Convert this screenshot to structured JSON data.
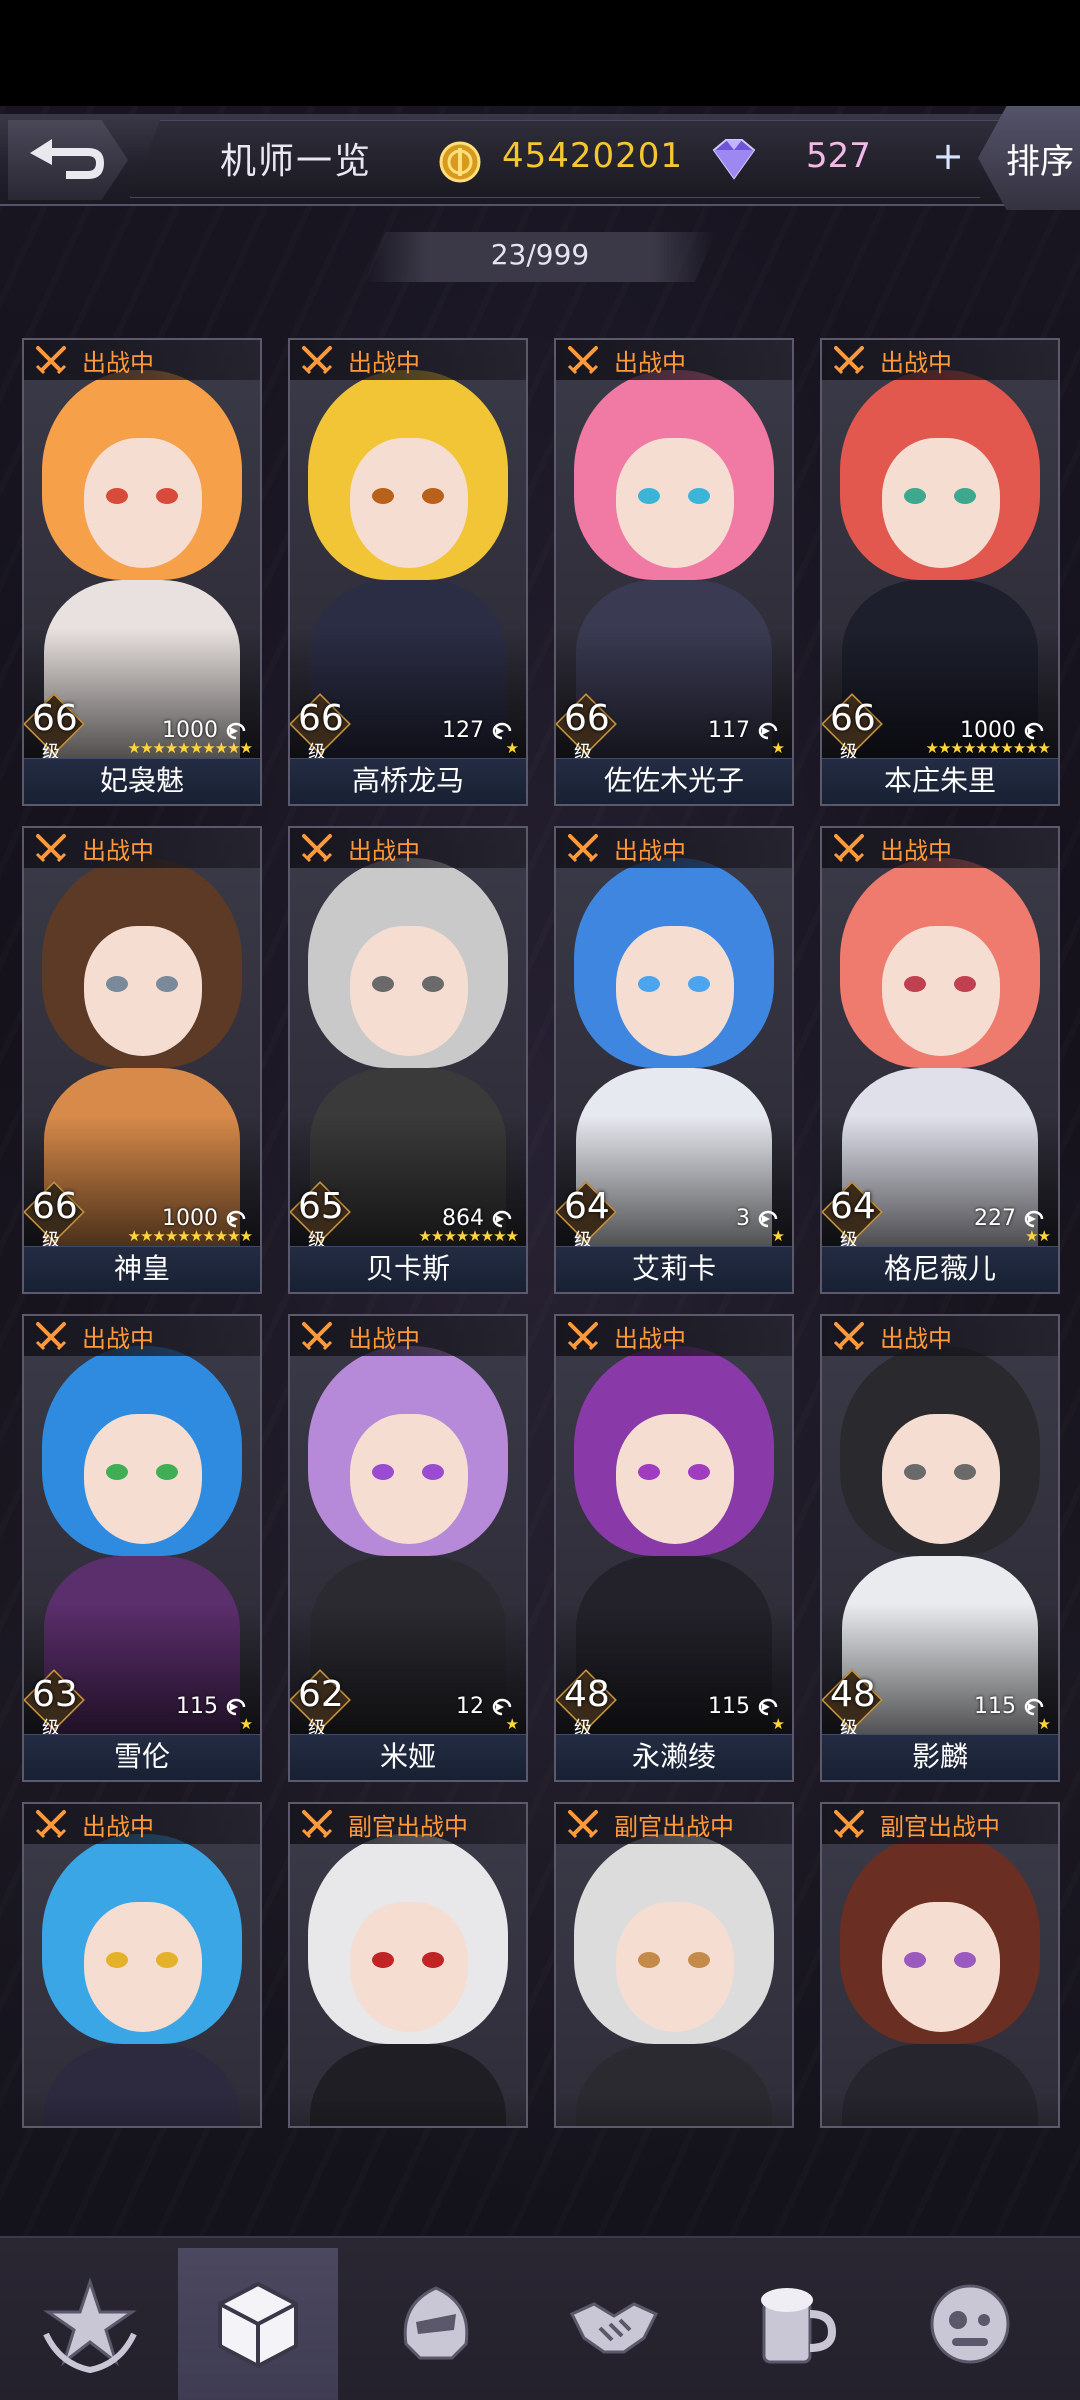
{
  "header": {
    "title": "机师一览",
    "coins": "45420201",
    "gems": "527",
    "add_label": "+",
    "sort_label": "排序",
    "pilot_count": "23/999"
  },
  "level_unit": "级",
  "cards": [
    {
      "name": "妃袅魅",
      "status": "出战中",
      "level": "66",
      "count": "1000",
      "stars": 10,
      "hair": "#f6a04a",
      "eyes": "#d84a3a",
      "outfit": "#e8e1df"
    },
    {
      "name": "高桥龙马",
      "status": "出战中",
      "level": "66",
      "count": "127",
      "stars": 1,
      "hair": "#f2c537",
      "eyes": "#b8611a",
      "outfit": "#2b2d44"
    },
    {
      "name": "佐佐木光子",
      "status": "出战中",
      "level": "66",
      "count": "117",
      "stars": 1,
      "hair": "#f07aa4",
      "eyes": "#3bb4d8",
      "outfit": "#3a3a52"
    },
    {
      "name": "本庄朱里",
      "status": "出战中",
      "level": "66",
      "count": "1000",
      "stars": 10,
      "hair": "#e2574e",
      "eyes": "#3ea88f",
      "outfit": "#1d1f2c"
    },
    {
      "name": "神皇",
      "status": "出战中",
      "level": "66",
      "count": "1000",
      "stars": 10,
      "hair": "#5c3a26",
      "eyes": "#7a8a9a",
      "outfit": "#d78a4a"
    },
    {
      "name": "贝卡斯",
      "status": "出战中",
      "level": "65",
      "count": "864",
      "stars": 8,
      "hair": "#c9c9c9",
      "eyes": "#6a6a6a",
      "outfit": "#3a3a3a"
    },
    {
      "name": "艾莉卡",
      "status": "出战中",
      "level": "64",
      "count": "3",
      "stars": 1,
      "hair": "#3e86e0",
      "eyes": "#4aa4ee",
      "outfit": "#e6e9ef"
    },
    {
      "name": "格尼薇儿",
      "status": "出战中",
      "level": "64",
      "count": "227",
      "stars": 2,
      "hair": "#ef7a6e",
      "eyes": "#c04050",
      "outfit": "#dfe0ea"
    },
    {
      "name": "雪伦",
      "status": "出战中",
      "level": "63",
      "count": "115",
      "stars": 1,
      "hair": "#2f8be0",
      "eyes": "#3fae54",
      "outfit": "#5b2e6c"
    },
    {
      "name": "米娅",
      "status": "出战中",
      "level": "62",
      "count": "12",
      "stars": 1,
      "hair": "#b68ad8",
      "eyes": "#9b4bd0",
      "outfit": "#2a2a30"
    },
    {
      "name": "永濑绫",
      "status": "出战中",
      "level": "48",
      "count": "115",
      "stars": 1,
      "hair": "#8a3aa8",
      "eyes": "#a03cc0",
      "outfit": "#23222a"
    },
    {
      "name": "影麟",
      "status": "出战中",
      "level": "48",
      "count": "115",
      "stars": 1,
      "hair": "#2a2a2e",
      "eyes": "#6a6a6a",
      "outfit": "#e9ebee"
    },
    {
      "name": "",
      "status": "出战中",
      "level": "",
      "count": "",
      "stars": 0,
      "hair": "#3aa6e6",
      "eyes": "#e4b12a",
      "outfit": "#2d2a40"
    },
    {
      "name": "",
      "status": "副官出战中",
      "level": "",
      "count": "",
      "stars": 0,
      "hair": "#e8e8ea",
      "eyes": "#c02424",
      "outfit": "#1e1e24"
    },
    {
      "name": "",
      "status": "副官出战中",
      "level": "",
      "count": "",
      "stars": 0,
      "hair": "#dcdcdc",
      "eyes": "#c48a4a",
      "outfit": "#2a2a30"
    },
    {
      "name": "",
      "status": "副官出战中",
      "level": "",
      "count": "",
      "stars": 0,
      "hair": "#6a2e22",
      "eyes": "#9a5ac0",
      "outfit": "#26242c"
    }
  ],
  "nav": [
    {
      "label": "基地",
      "icon": "base-star-icon",
      "active": false
    },
    {
      "label": "仓库",
      "icon": "warehouse-cube-icon",
      "active": true
    },
    {
      "label": "编队",
      "icon": "formation-helmet-icon",
      "active": false
    },
    {
      "label": "社交",
      "icon": "handshake-icon",
      "active": false
    },
    {
      "label": "酒馆",
      "icon": "tavern-mug-icon",
      "active": false
    },
    {
      "label": "商城",
      "icon": "shop-robot-icon",
      "active": false
    }
  ],
  "colors": {
    "status_orange": "#ff9a3c",
    "coin_gold": "#f4c630",
    "gem_pink": "#f3b9e7",
    "star_yellow": "#ffd53a"
  }
}
